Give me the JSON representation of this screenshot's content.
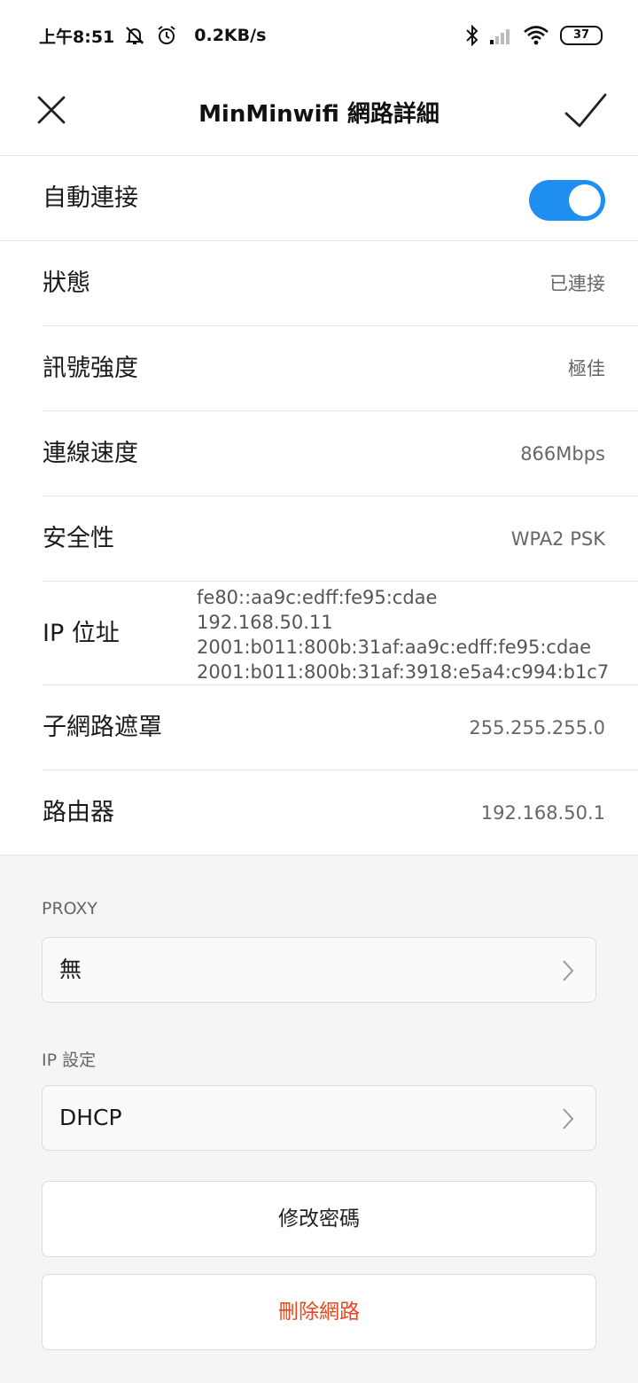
{
  "status_bar": {
    "time": "上午8:51",
    "net_speed": "0.2KB/s",
    "battery": "37",
    "icons": [
      "mute-icon",
      "alarm-icon",
      "bluetooth-icon",
      "signal-icon",
      "wifi-icon"
    ]
  },
  "header": {
    "title": "MinMinwifi 網路詳細",
    "close_icon": "close-icon",
    "confirm_icon": "check-icon"
  },
  "details": {
    "auto_connect": {
      "label": "自動連接",
      "enabled": true
    },
    "status": {
      "label": "狀態",
      "value": "已連接"
    },
    "signal": {
      "label": "訊號強度",
      "value": "極佳"
    },
    "speed": {
      "label": "連線速度",
      "value": "866Mbps"
    },
    "security": {
      "label": "安全性",
      "value": "WPA2 PSK"
    },
    "ip": {
      "label": "IP 位址",
      "values": [
        "fe80::aa9c:edff:fe95:cdae",
        "192.168.50.11",
        "2001:b011:800b:31af:aa9c:edff:fe95:cdae",
        "2001:b011:800b:31af:3918:e5a4:c994:b1c7"
      ]
    },
    "subnet": {
      "label": "子網路遮罩",
      "value": "255.255.255.0"
    },
    "router": {
      "label": "路由器",
      "value": "192.168.50.1"
    }
  },
  "proxy": {
    "label": "PROXY",
    "value": "無"
  },
  "ip_settings": {
    "label": "IP 設定",
    "value": "DHCP"
  },
  "actions": {
    "change_password": "修改密碼",
    "delete_network": "刪除網路"
  },
  "colors": {
    "accent": "#1e8ff0",
    "danger": "#e8481f"
  }
}
